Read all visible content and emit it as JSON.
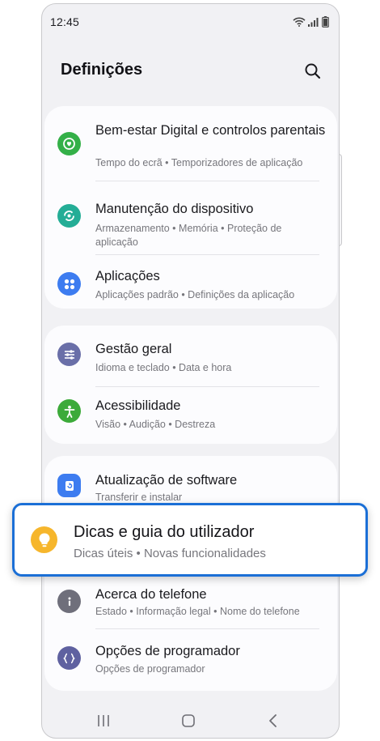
{
  "status_bar": {
    "time": "12:45"
  },
  "header": {
    "title": "Definições"
  },
  "groups": [
    {
      "items": [
        {
          "title": "Bem-estar Digital e controlos parentais",
          "subtitle": "Tempo do ecrã  •  Temporizadores de aplicação",
          "icon": "digital-wellbeing-icon",
          "color": "#34b048"
        },
        {
          "title": "Manutenção do dispositivo",
          "subtitle": "Armazenamento  •  Memória  •  Proteção de aplicação",
          "icon": "device-care-icon",
          "color": "#24ad96"
        },
        {
          "title": "Aplicações",
          "subtitle": "Aplicações padrão  •  Definições da aplicação",
          "icon": "apps-icon",
          "color": "#3d7cf0"
        }
      ]
    },
    {
      "items": [
        {
          "title": "Gestão geral",
          "subtitle": "Idioma e teclado  •  Data e hora",
          "icon": "sliders-icon",
          "color": "#6a6fa8"
        },
        {
          "title": "Acessibilidade",
          "subtitle": "Visão  •  Audição  •  Destreza",
          "icon": "accessibility-icon",
          "color": "#3caa3a"
        }
      ]
    },
    {
      "items": [
        {
          "title": "Atualização de software",
          "subtitle": "Transferir e instalar",
          "icon": "software-update-icon",
          "color": "#3d7cf0"
        },
        {
          "title": "Acerca do telefone",
          "subtitle": "Estado  •  Informação legal  •  Nome do telefone",
          "icon": "info-icon",
          "color": "#6f6f7b"
        },
        {
          "title": "Opções de programador",
          "subtitle": "Opções de programador",
          "icon": "developer-options-icon",
          "color": "#5f61a0"
        }
      ]
    }
  ],
  "highlight": {
    "title": "Dicas e guia do utilizador",
    "subtitle": "Dicas úteis  •  Novas funcionalidades",
    "icon": "lightbulb-icon",
    "color": "#f6b62c"
  },
  "accent_color": "#1b6fd6",
  "nav_bar": {
    "icons": [
      "recent-apps-icon",
      "home-icon",
      "back-icon"
    ]
  }
}
